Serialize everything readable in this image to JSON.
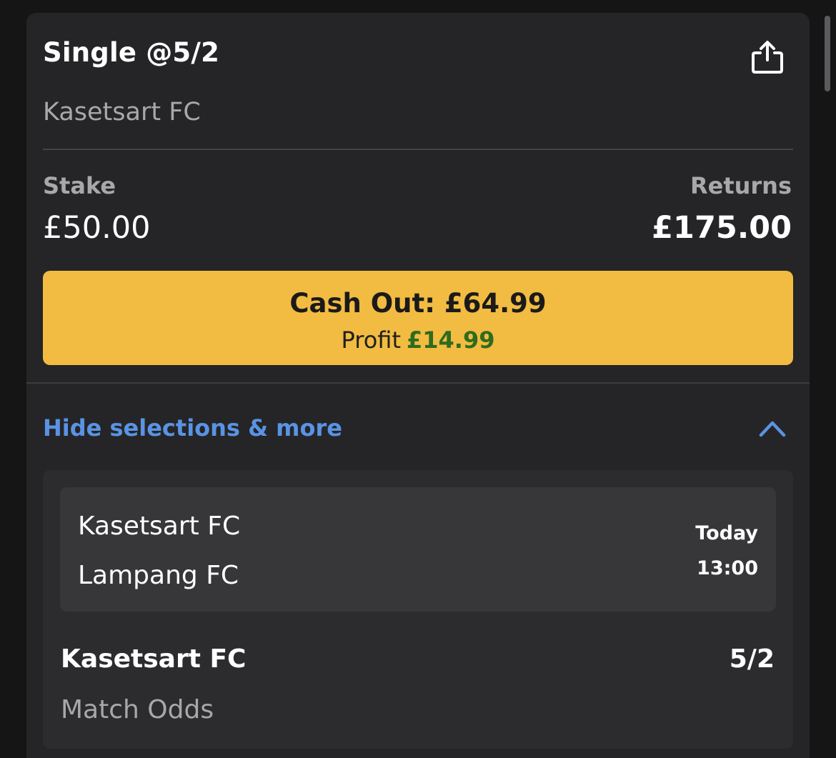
{
  "bet": {
    "title": "Single @5/2",
    "subtitle": "Kasetsart FC",
    "stake_label": "Stake",
    "stake_value": "£50.00",
    "returns_label": "Returns",
    "returns_value": "£175.00"
  },
  "cashout": {
    "label": "Cash Out: £64.99",
    "profit_label": "Profit",
    "profit_value": "£14.99"
  },
  "toggle": {
    "label": "Hide selections & more"
  },
  "event": {
    "home_team": "Kasetsart FC",
    "away_team": "Lampang FC",
    "day": "Today",
    "time": "13:00"
  },
  "selection": {
    "name": "Kasetsart FC",
    "odds": "5/2",
    "market": "Match Odds"
  },
  "colors": {
    "background": "#151516",
    "card": "#252527",
    "accent_yellow": "#f2bb41",
    "profit_green": "#2f6b1e",
    "link_blue": "#5a93e4"
  },
  "icons": {
    "share": "share-icon",
    "chevron": "chevron-up-icon"
  }
}
